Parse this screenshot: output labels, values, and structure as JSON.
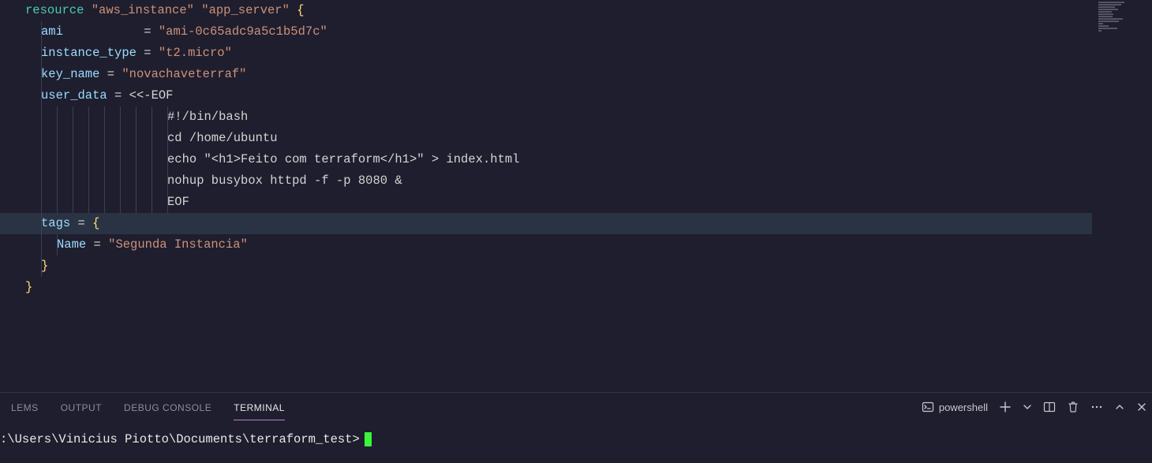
{
  "editor": {
    "lines": [
      {
        "indent": 0,
        "tokens": [
          {
            "t": "type",
            "v": "resource"
          },
          {
            "t": "plain",
            "v": " "
          },
          {
            "t": "string",
            "v": "\"aws_instance\""
          },
          {
            "t": "plain",
            "v": " "
          },
          {
            "t": "string",
            "v": "\"app_server\""
          },
          {
            "t": "plain",
            "v": " "
          },
          {
            "t": "punc",
            "v": "{"
          }
        ]
      },
      {
        "indent": 1,
        "tokens": [
          {
            "t": "key",
            "v": "ami"
          },
          {
            "t": "plain",
            "v": "           "
          },
          {
            "t": "op",
            "v": "="
          },
          {
            "t": "plain",
            "v": " "
          },
          {
            "t": "string",
            "v": "\"ami-0c65adc9a5c1b5d7c\""
          }
        ]
      },
      {
        "indent": 1,
        "tokens": [
          {
            "t": "key",
            "v": "instance_type"
          },
          {
            "t": "plain",
            "v": " "
          },
          {
            "t": "op",
            "v": "="
          },
          {
            "t": "plain",
            "v": " "
          },
          {
            "t": "string",
            "v": "\"t2.micro\""
          }
        ]
      },
      {
        "indent": 1,
        "tokens": [
          {
            "t": "key",
            "v": "key_name"
          },
          {
            "t": "plain",
            "v": " "
          },
          {
            "t": "op",
            "v": "="
          },
          {
            "t": "plain",
            "v": " "
          },
          {
            "t": "string",
            "v": "\"novachaveterraf\""
          }
        ]
      },
      {
        "indent": 1,
        "tokens": [
          {
            "t": "key",
            "v": "user_data"
          },
          {
            "t": "plain",
            "v": " "
          },
          {
            "t": "op",
            "v": "="
          },
          {
            "t": "plain",
            "v": " "
          },
          {
            "t": "plain",
            "v": "<<-"
          },
          {
            "t": "plain",
            "v": "EOF"
          }
        ]
      },
      {
        "indent": 9,
        "tokens": [
          {
            "t": "plain",
            "v": "#!/bin/bash"
          }
        ]
      },
      {
        "indent": 9,
        "tokens": [
          {
            "t": "plain",
            "v": "cd /home/ubuntu"
          }
        ]
      },
      {
        "indent": 9,
        "tokens": [
          {
            "t": "plain",
            "v": "echo \"<h1>Feito com terraform</h1>\" > index.html"
          }
        ]
      },
      {
        "indent": 9,
        "tokens": [
          {
            "t": "plain",
            "v": "nohup busybox httpd -f -p 8080 &"
          }
        ]
      },
      {
        "indent": 9,
        "tokens": [
          {
            "t": "plain",
            "v": "EOF"
          }
        ]
      },
      {
        "indent": 1,
        "highlight": true,
        "tokens": [
          {
            "t": "key",
            "v": "tags"
          },
          {
            "t": "plain",
            "v": " "
          },
          {
            "t": "op",
            "v": "="
          },
          {
            "t": "plain",
            "v": " "
          },
          {
            "t": "punc",
            "v": "{"
          }
        ]
      },
      {
        "indent": 2,
        "tokens": [
          {
            "t": "key",
            "v": "Name"
          },
          {
            "t": "plain",
            "v": " "
          },
          {
            "t": "op",
            "v": "="
          },
          {
            "t": "plain",
            "v": " "
          },
          {
            "t": "string",
            "v": "\"Segunda Instancia\""
          }
        ]
      },
      {
        "indent": 1,
        "tokens": [
          {
            "t": "punc",
            "v": "}"
          }
        ]
      },
      {
        "indent": 0,
        "tokens": [
          {
            "t": "punc",
            "v": "}"
          }
        ]
      }
    ]
  },
  "panel": {
    "tabs": {
      "problems": "LEMS",
      "output": "OUTPUT",
      "debug": "DEBUG CONSOLE",
      "terminal": "TERMINAL"
    },
    "shell_label": "powershell"
  },
  "terminal": {
    "prompt": ":\\Users\\Vinicius Piotto\\Documents\\terraform_test>"
  }
}
